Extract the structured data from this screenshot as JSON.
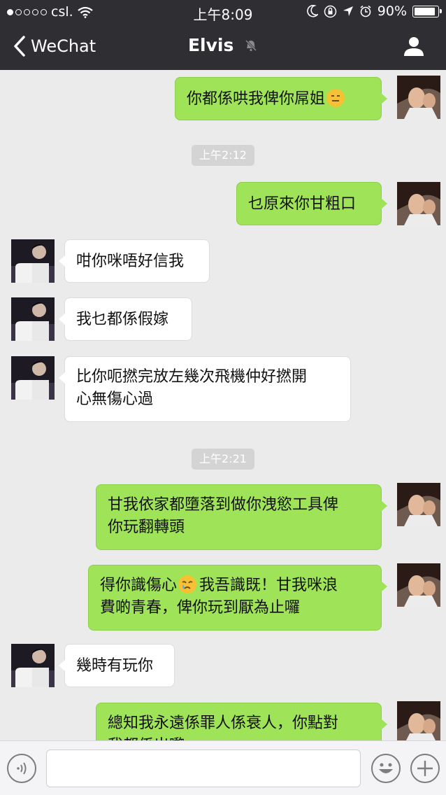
{
  "status_bar": {
    "carrier": "csl.",
    "time": "上午8:09",
    "battery": "90%",
    "battery_level": 0.9
  },
  "nav": {
    "back_label": "WeChat",
    "title": "Elvis",
    "icons": [
      "chevron-left-icon",
      "muted-bell-icon",
      "person-icon"
    ]
  },
  "messages": [
    {
      "dir": "out",
      "text": "你都係哄我俾你屌姐",
      "emoji": "expressionless-face"
    },
    {
      "type": "time",
      "text": "上午2:12"
    },
    {
      "dir": "out",
      "text": "乜原來你甘粗口"
    },
    {
      "dir": "in",
      "text": "咁你咪唔好信我"
    },
    {
      "dir": "in",
      "text": "我乜都係假嫁"
    },
    {
      "dir": "in",
      "line1": "比你呃撚完放左幾次飛機仲好撚開",
      "line2": "心無傷心過"
    },
    {
      "type": "time",
      "text": "上午2:21"
    },
    {
      "dir": "out",
      "line1": "甘我依家都墮落到做你洩慾工具俾",
      "line2": "你玩翻轉頭"
    },
    {
      "dir": "out",
      "line1a": "得你識傷心",
      "emoji": "crying-face",
      "line1b": "我吾識既！甘我咪浪",
      "line2": "費啲青春，俾你玩到厭為止囉"
    },
    {
      "dir": "in",
      "text": "幾時有玩你"
    },
    {
      "dir": "out",
      "line1": "總知我永遠係罪人係衰人，你點對",
      "line2": "我都係出嚟"
    }
  ],
  "input_bar": {
    "icons": [
      "voice-icon",
      "emoji-icon",
      "plus-icon"
    ]
  },
  "colors": {
    "header": "#2f2f33",
    "outgoing_bubble": "#9fe358",
    "incoming_bubble": "#ffffff",
    "chat_bg": "#ebebeb"
  }
}
